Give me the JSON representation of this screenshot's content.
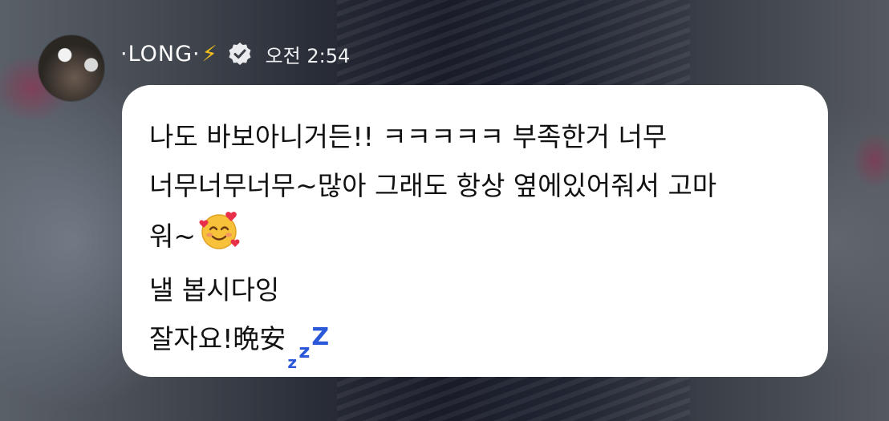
{
  "header": {
    "username": "·LONG·",
    "badge_bolt": "⚡",
    "verified_icon": "verified-badge",
    "timestamp": "오전 2:54"
  },
  "message": {
    "lines": [
      "나도 바보아니거든!! ㅋㅋㅋㅋㅋ 부족한거 너무",
      "너무너무너무~많아 그래도 항상 옆에있어줘서 고마",
      "워~",
      "낼 봅시다잉",
      "잘자요!晩安"
    ],
    "emoji_smiling_hearts": "smiling-face-with-hearts",
    "emoji_zzz": "zzz"
  },
  "colors": {
    "bubble_bg": "#ffffff",
    "text": "#111111",
    "bolt": "#f6c21a",
    "zzz": "#2b58d9"
  }
}
